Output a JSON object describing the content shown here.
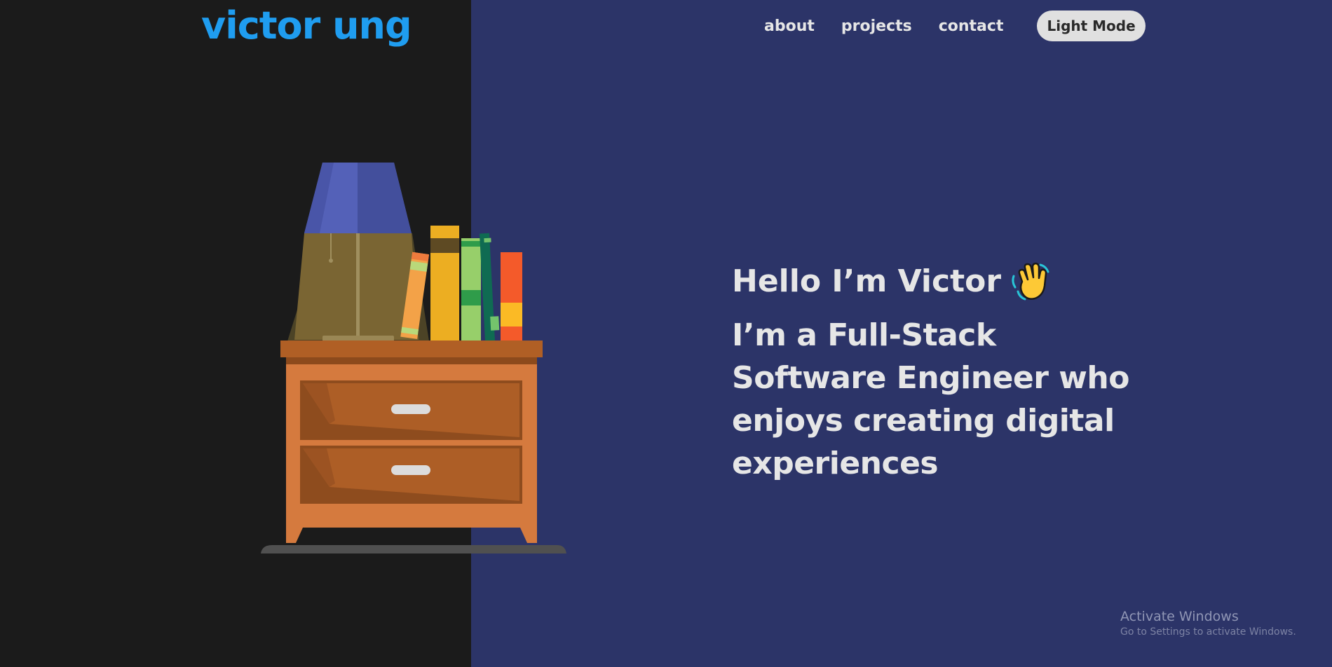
{
  "header": {
    "logo_text": "victor ung",
    "nav": {
      "about": "about",
      "projects": "projects",
      "contact": "contact"
    },
    "mode_toggle_label": "Light Mode"
  },
  "hero": {
    "greeting": "Hello I’m Victor",
    "greeting_icon": "waving-hand-icon",
    "tagline": "I’m a Full-Stack Software Engineer who enjoys creating digital experiences"
  },
  "illustration": {
    "subject": "nightstand-with-lamp-and-books"
  },
  "watermark": {
    "title": "Activate Windows",
    "subtitle": "Go to Settings to activate Windows."
  },
  "colors": {
    "left_background": "#1b1b1b",
    "right_background": "#2c3468",
    "logo": "#1f9df0",
    "text": "#e6e6e6",
    "button_background": "#e0e0e0"
  }
}
